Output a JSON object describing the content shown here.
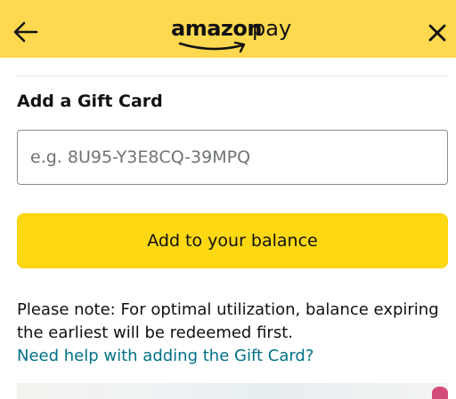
{
  "header": {
    "logo_amazon": "amazon",
    "logo_pay": "pay",
    "back_icon": "arrow-left-icon",
    "close_icon": "close-icon",
    "bg_color": "#fed84f"
  },
  "gift_card": {
    "section_title": "Add a Gift Card",
    "input_placeholder": "e.g. 8U95-Y3E8CQ-39MPQ",
    "input_value": "",
    "button_label": "Add to your balance",
    "button_color": "#ffd814"
  },
  "note": {
    "text": "Please note: For optimal utilization, balance expiring the earliest will be redeemed first.",
    "help_link": "Need help with adding the Gift Card?",
    "link_color": "#007185"
  }
}
